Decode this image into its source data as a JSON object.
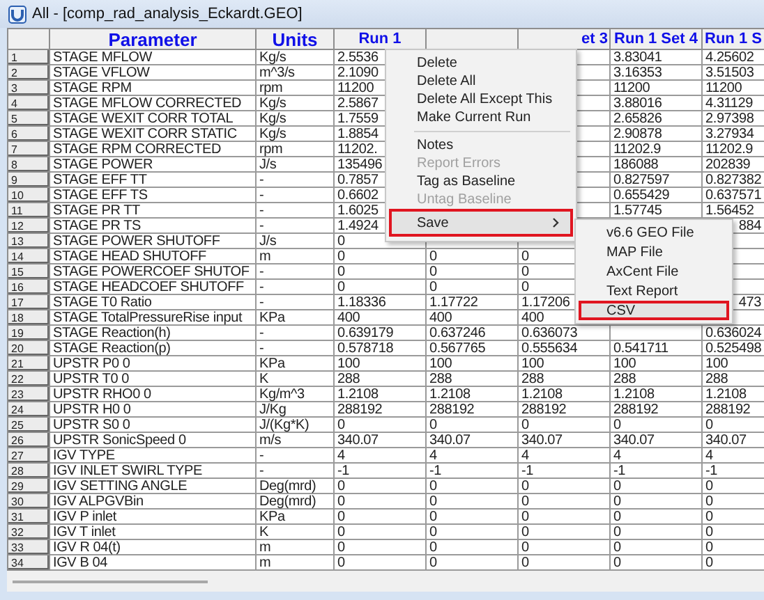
{
  "window": {
    "title": "All - [comp_rad_analysis_Eckardt.GEO]"
  },
  "columns": {
    "parameter": "Parameter",
    "units": "Units",
    "set_1": "Run 1",
    "set_3": {
      "text": "et 3",
      "clipped": true
    },
    "set_4": "Run 1 Set 4",
    "set_5": "Run 1 S"
  },
  "rows": [
    {
      "number": "1",
      "parameter": "STAGE MFLOW",
      "units": "Kg/s",
      "set_1": "2.5536",
      "set_4": "3.83041",
      "set_5": "4.25602"
    },
    {
      "number": "2",
      "parameter": "STAGE VFLOW",
      "units": "m^3/s",
      "set_1": "2.1090",
      "set_4": "3.16353",
      "set_5": "3.51503"
    },
    {
      "number": "3",
      "parameter": "STAGE RPM",
      "units": "rpm",
      "set_1": "11200",
      "set_4": "11200",
      "set_5": "11200"
    },
    {
      "number": "4",
      "parameter": "STAGE MFLOW CORRECTED",
      "units": "Kg/s",
      "set_1": "2.5867",
      "set_4": "3.88016",
      "set_5": "4.31129"
    },
    {
      "number": "5",
      "parameter": "STAGE WEXIT CORR TOTAL",
      "units": "Kg/s",
      "set_1": "1.7559",
      "set_4": "2.65826",
      "set_5": "2.97398"
    },
    {
      "number": "6",
      "parameter": "STAGE WEXIT CORR STATIC",
      "units": "Kg/s",
      "set_1": "1.8854",
      "set_4": "2.90878",
      "set_5": "3.27934"
    },
    {
      "number": "7",
      "parameter": "STAGE RPM CORRECTED",
      "units": "rpm",
      "set_1": "11202.",
      "set_4": "11202.9",
      "set_5": "11202.9"
    },
    {
      "number": "8",
      "parameter": "STAGE POWER",
      "units": "J/s",
      "set_1": "135496",
      "set_4": "186088",
      "set_5": "202839"
    },
    {
      "number": "9",
      "parameter": "STAGE EFF TT",
      "units": "-",
      "set_1": "0.7857",
      "set_4": "0.827597",
      "set_5": "0.827382"
    },
    {
      "number": "10",
      "parameter": "STAGE EFF TS",
      "units": "-",
      "set_1": "0.6602",
      "set_4": "0.655429",
      "set_5": "0.637571"
    },
    {
      "number": "11",
      "parameter": "STAGE PR TT",
      "units": "-",
      "set_1": "1.6025",
      "set_4": "1.57745",
      "set_5": "1.56452"
    },
    {
      "number": "12",
      "parameter": "STAGE PR TS",
      "units": "-",
      "set_1": "1.4924",
      "set_5": {
        "text": "884",
        "clipped": true
      }
    },
    {
      "number": "13",
      "parameter": "STAGE POWER SHUTOFF",
      "units": "J/s",
      "set_1": "0"
    },
    {
      "number": "14",
      "parameter": "STAGE HEAD SHUTOFF",
      "units": "m",
      "set_1": "0",
      "set_2": "0",
      "set_3": "0"
    },
    {
      "number": "15",
      "parameter": "STAGE POWERCOEF SHUTOF",
      "units": "-",
      "set_1": "0",
      "set_2": "0",
      "set_3": "0"
    },
    {
      "number": "16",
      "parameter": "STAGE HEADCOEF SHUTOFF",
      "units": "-",
      "set_1": "0",
      "set_2": "0",
      "set_3": "0"
    },
    {
      "number": "17",
      "parameter": "STAGE T0 Ratio",
      "units": "-",
      "set_1": "1.18336",
      "set_2": "1.17722",
      "set_3": "1.17206",
      "set_5": {
        "text": "473",
        "clipped": true
      }
    },
    {
      "number": "18",
      "parameter": "STAGE TotalPressureRise input",
      "units": "KPa",
      "set_1": "400",
      "set_2": "400",
      "set_3": "400"
    },
    {
      "number": "19",
      "parameter": "STAGE Reaction(h)",
      "units": "-",
      "set_1": "0.639179",
      "set_2": "0.637246",
      "set_3": "0.636073",
      "set_5": "0.636024"
    },
    {
      "number": "20",
      "parameter": "STAGE Reaction(p)",
      "units": "-",
      "set_1": "0.578718",
      "set_2": "0.567765",
      "set_3": "0.555634",
      "set_4": "0.541711",
      "set_5": "0.525498"
    },
    {
      "number": "21",
      "parameter": "UPSTR P0 0",
      "units": "KPa",
      "set_1": "100",
      "set_2": "100",
      "set_3": "100",
      "set_4": "100",
      "set_5": "100"
    },
    {
      "number": "22",
      "parameter": "UPSTR T0 0",
      "units": "K",
      "set_1": "288",
      "set_2": "288",
      "set_3": "288",
      "set_4": "288",
      "set_5": "288"
    },
    {
      "number": "23",
      "parameter": "UPSTR RHO0 0",
      "units": "Kg/m^3",
      "set_1": "1.2108",
      "set_2": "1.2108",
      "set_3": "1.2108",
      "set_4": "1.2108",
      "set_5": "1.2108"
    },
    {
      "number": "24",
      "parameter": "UPSTR H0 0",
      "units": "J/Kg",
      "set_1": "288192",
      "set_2": "288192",
      "set_3": "288192",
      "set_4": "288192",
      "set_5": "288192"
    },
    {
      "number": "25",
      "parameter": "UPSTR S0 0",
      "units": "J/(Kg*K)",
      "set_1": "0",
      "set_2": "0",
      "set_3": "0",
      "set_4": "0",
      "set_5": "0"
    },
    {
      "number": "26",
      "parameter": "UPSTR SonicSpeed 0",
      "units": "m/s",
      "set_1": "340.07",
      "set_2": "340.07",
      "set_3": "340.07",
      "set_4": "340.07",
      "set_5": "340.07"
    },
    {
      "number": "27",
      "parameter": "IGV TYPE",
      "units": "-",
      "set_1": "4",
      "set_2": "4",
      "set_3": "4",
      "set_4": "4",
      "set_5": "4"
    },
    {
      "number": "28",
      "parameter": "IGV INLET SWIRL TYPE",
      "units": "-",
      "set_1": "-1",
      "set_2": "-1",
      "set_3": "-1",
      "set_4": "-1",
      "set_5": "-1"
    },
    {
      "number": "29",
      "parameter": "IGV SETTING ANGLE",
      "units": "Deg(mrd)",
      "set_1": "0",
      "set_2": "0",
      "set_3": "0",
      "set_4": "0",
      "set_5": "0"
    },
    {
      "number": "30",
      "parameter": "IGV ALPGVBin",
      "units": "Deg(mrd)",
      "set_1": "0",
      "set_2": "0",
      "set_3": "0",
      "set_4": "0",
      "set_5": "0"
    },
    {
      "number": "31",
      "parameter": "IGV P inlet",
      "units": "KPa",
      "set_1": "0",
      "set_2": "0",
      "set_3": "0",
      "set_4": "0",
      "set_5": "0"
    },
    {
      "number": "32",
      "parameter": "IGV T inlet",
      "units": "K",
      "set_1": "0",
      "set_2": "0",
      "set_3": "0",
      "set_4": "0",
      "set_5": "0"
    },
    {
      "number": "33",
      "parameter": "IGV R 04(t)",
      "units": "m",
      "set_1": "0",
      "set_2": "0",
      "set_3": "0",
      "set_4": "0",
      "set_5": "0"
    },
    {
      "number": "34",
      "parameter": "IGV B 04",
      "units": "m",
      "set_1": "0",
      "set_2": "0",
      "set_3": "0",
      "set_4": "0",
      "set_5": "0"
    }
  ],
  "context_menu": {
    "items": [
      {
        "kind": "item",
        "label": "Delete",
        "disabled": false,
        "selected": false
      },
      {
        "kind": "item",
        "label": "Delete All",
        "disabled": false,
        "selected": false
      },
      {
        "kind": "item",
        "label": "Delete All Except This",
        "disabled": false,
        "selected": false
      },
      {
        "kind": "item",
        "label": "Make Current Run",
        "disabled": false,
        "selected": false
      },
      {
        "kind": "separator"
      },
      {
        "kind": "item",
        "label": "Notes",
        "disabled": false,
        "selected": false
      },
      {
        "kind": "item",
        "label": "Report Errors",
        "disabled": true,
        "selected": false
      },
      {
        "kind": "item",
        "label": "Tag as Baseline",
        "disabled": false,
        "selected": false
      },
      {
        "kind": "item",
        "label": "Untag Baseline",
        "disabled": true,
        "selected": false
      },
      {
        "kind": "submenu",
        "label": "Save",
        "disabled": false,
        "selected": true,
        "outlined": true
      }
    ]
  },
  "submenu": {
    "items": [
      {
        "label": "v6.6 GEO File",
        "selected": false,
        "outlined": false
      },
      {
        "label": "MAP File",
        "selected": false,
        "outlined": false
      },
      {
        "label": "AxCent File",
        "selected": false,
        "outlined": false
      },
      {
        "label": "Text Report",
        "selected": false,
        "outlined": false
      },
      {
        "label": "CSV",
        "selected": true,
        "outlined": true
      }
    ]
  }
}
